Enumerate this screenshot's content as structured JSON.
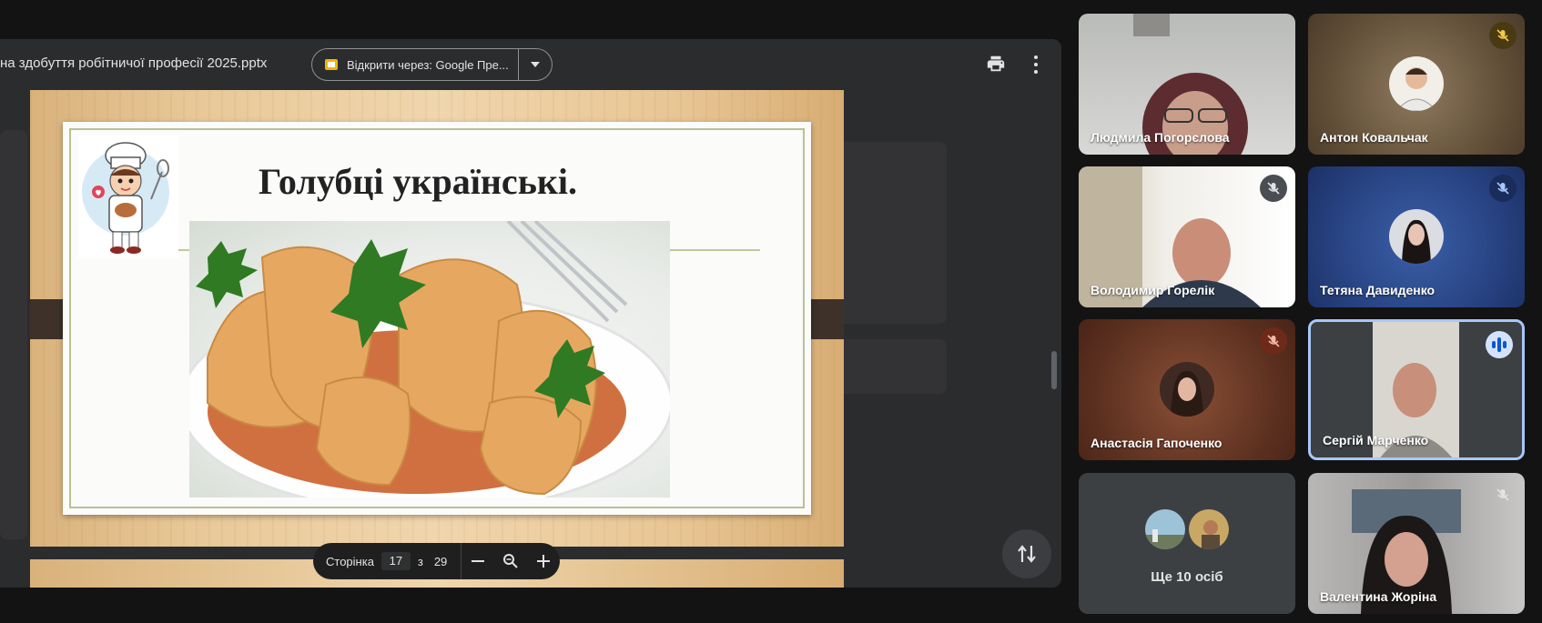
{
  "viewer": {
    "file_name": "на здобуття робітничої професії 2025.pptx",
    "open_with_label": "Відкрити через: Google Пре...",
    "print_icon": "print-icon",
    "more_icon": "more-vert-icon"
  },
  "slide": {
    "title": "Голубці українські.",
    "illustration": "chef-illustration",
    "photo": "cabbage-rolls-photo"
  },
  "page_control": {
    "page_label": "Сторінка",
    "current_page": "17",
    "of_label": "з",
    "total_pages": "29"
  },
  "participants": [
    {
      "name": "Людмила Погорєлова",
      "muted": false,
      "mode": "video"
    },
    {
      "name": "Антон Ковальчак",
      "muted": true,
      "mode": "avatar"
    },
    {
      "name": "Володимир Горелік",
      "muted": true,
      "mode": "video"
    },
    {
      "name": "Тетяна Давиденко",
      "muted": true,
      "mode": "avatar"
    },
    {
      "name": "Анастасія Гапоченко",
      "muted": true,
      "mode": "avatar"
    },
    {
      "name": "Сергій Марченко",
      "muted": false,
      "speaking": true,
      "mode": "video"
    },
    {
      "name": "Валентина Жоріна",
      "muted": true,
      "mode": "video"
    }
  ],
  "others": {
    "label": "Ще 10 осіб"
  },
  "colors": {
    "background": "#131314",
    "panel": "#2b2c2e",
    "speaking_border": "#a8c7fa",
    "mic_off_badge": "#8c2f1f"
  }
}
